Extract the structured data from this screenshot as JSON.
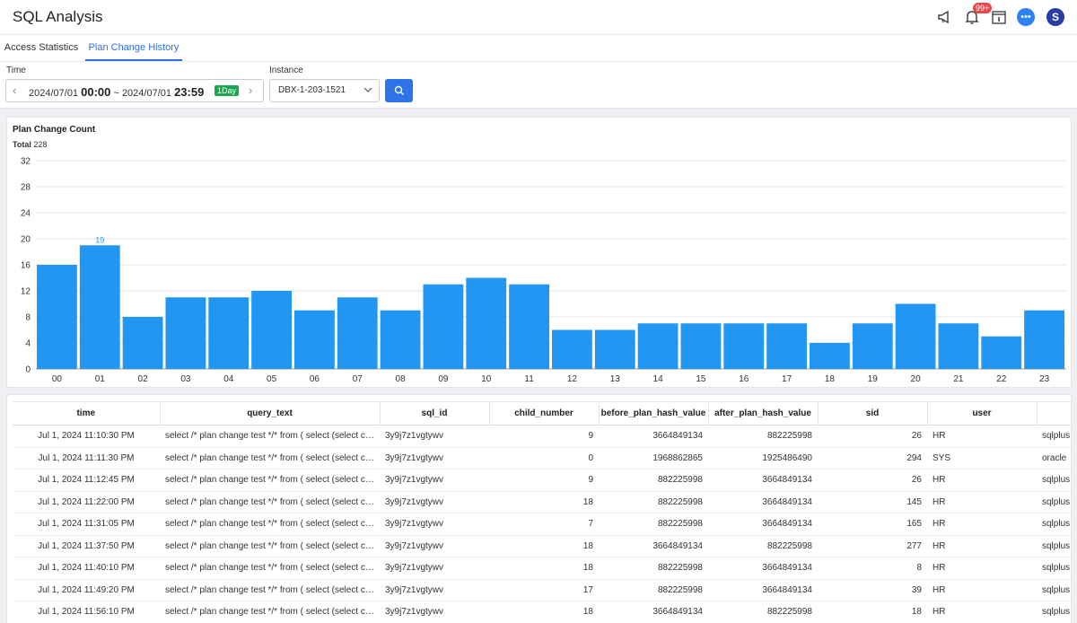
{
  "header": {
    "title": "SQL Analysis",
    "notification_badge": "99+",
    "chat_label": "•••",
    "avatar_initial": "S"
  },
  "tabs": [
    {
      "label": "Access Statistics",
      "active": false
    },
    {
      "label": "Plan Change History",
      "active": true
    }
  ],
  "filters": {
    "time_label": "Time",
    "time_start_date": "2024/07/01",
    "time_start_clock": "00:00",
    "time_sep": "~",
    "time_end_date": "2024/07/01",
    "time_end_clock": "23:59",
    "range_badge": "1Day",
    "instance_label": "Instance",
    "instance_value": "DBX-1-203-1521"
  },
  "chart": {
    "title": "Plan Change Count",
    "total_label": "Total",
    "total_value": "228"
  },
  "chart_data": {
    "type": "bar",
    "categories": [
      "00",
      "01",
      "02",
      "03",
      "04",
      "05",
      "06",
      "07",
      "08",
      "09",
      "10",
      "11",
      "12",
      "13",
      "14",
      "15",
      "16",
      "17",
      "18",
      "19",
      "20",
      "21",
      "22",
      "23"
    ],
    "values": [
      16,
      19,
      8,
      11,
      11,
      12,
      9,
      11,
      9,
      13,
      14,
      13,
      6,
      6,
      7,
      7,
      7,
      7,
      4,
      7,
      10,
      7,
      5,
      9
    ],
    "highlight_label": {
      "category": "01",
      "value": "19"
    },
    "ylim": [
      0,
      32
    ],
    "yticks": [
      0,
      4,
      8,
      12,
      16,
      20,
      24,
      28,
      32
    ],
    "grid": true,
    "bar_color": "#2196f3"
  },
  "table": {
    "columns": [
      "time",
      "query_text",
      "sql_id",
      "child_number",
      "before_plan_hash_value",
      "after_plan_hash_value",
      "sid",
      "user",
      ""
    ],
    "rows": [
      [
        "Jul 1, 2024 11:10:30 PM",
        "select /* plan change test */* from ( select (select count(*) from",
        "3y9j7z1vgtywv",
        "9",
        "3664849134",
        "882225998",
        "26",
        "HR",
        "sqlplus"
      ],
      [
        "Jul 1, 2024 11:11:30 PM",
        "select /* plan change test */* from ( select (select count(*) from",
        "3y9j7z1vgtywv",
        "0",
        "1968862865",
        "1925486490",
        "294",
        "SYS",
        "oracle"
      ],
      [
        "Jul 1, 2024 11:12:45 PM",
        "select /* plan change test */* from ( select (select count(*) from",
        "3y9j7z1vgtywv",
        "9",
        "882225998",
        "3664849134",
        "26",
        "HR",
        "sqlplus"
      ],
      [
        "Jul 1, 2024 11:22:00 PM",
        "select /* plan change test */* from ( select (select count(*) from",
        "3y9j7z1vgtywv",
        "18",
        "882225998",
        "3664849134",
        "145",
        "HR",
        "sqlplus"
      ],
      [
        "Jul 1, 2024 11:31:05 PM",
        "select /* plan change test */* from ( select (select count(*) from",
        "3y9j7z1vgtywv",
        "7",
        "882225998",
        "3664849134",
        "165",
        "HR",
        "sqlplus"
      ],
      [
        "Jul 1, 2024 11:37:50 PM",
        "select /* plan change test */* from ( select (select count(*) from",
        "3y9j7z1vgtywv",
        "18",
        "3664849134",
        "882225998",
        "277",
        "HR",
        "sqlplus"
      ],
      [
        "Jul 1, 2024 11:40:10 PM",
        "select /* plan change test */* from ( select (select count(*) from",
        "3y9j7z1vgtywv",
        "18",
        "882225998",
        "3664849134",
        "8",
        "HR",
        "sqlplus"
      ],
      [
        "Jul 1, 2024 11:49:20 PM",
        "select /* plan change test */* from ( select (select count(*) from",
        "3y9j7z1vgtywv",
        "17",
        "882225998",
        "3664849134",
        "39",
        "HR",
        "sqlplus"
      ],
      [
        "Jul 1, 2024 11:56:10 PM",
        "select /* plan change test */* from ( select (select count(*) from",
        "3y9j7z1vgtywv",
        "18",
        "3664849134",
        "882225998",
        "18",
        "HR",
        "sqlplus"
      ]
    ]
  }
}
